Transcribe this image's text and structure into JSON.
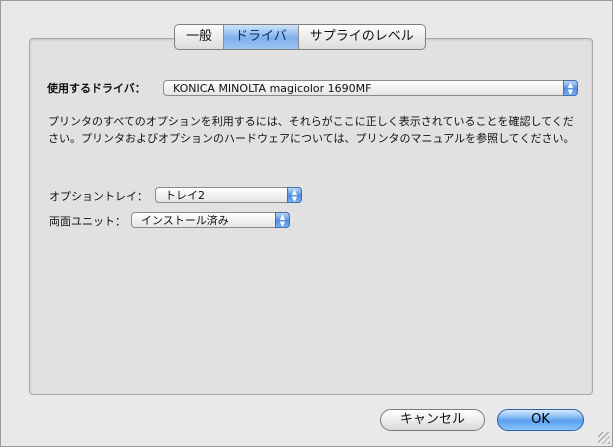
{
  "tabs": [
    {
      "label": "一般"
    },
    {
      "label": "ドライバ"
    },
    {
      "label": "サプライのレベル"
    }
  ],
  "driver": {
    "label": "使用するドライバ：",
    "selected": "KONICA MINOLTA magicolor 1690MF"
  },
  "description": "プリンタのすべてのオプションを利用するには、それらがここに正しく表示されていることを確認してください。プリンタおよびオプションのハードウェアについては、プリンタのマニュアルを参照してください。",
  "options": {
    "tray_label": "オプショントレイ：",
    "tray_value": "トレイ2",
    "duplex_label": "両面ユニット：",
    "duplex_value": "インストール済み"
  },
  "buttons": {
    "cancel": "キャンセル",
    "ok": "OK"
  },
  "colors": {
    "accent": "#5aa0ee",
    "selected_tab": "#7fb0ec"
  }
}
